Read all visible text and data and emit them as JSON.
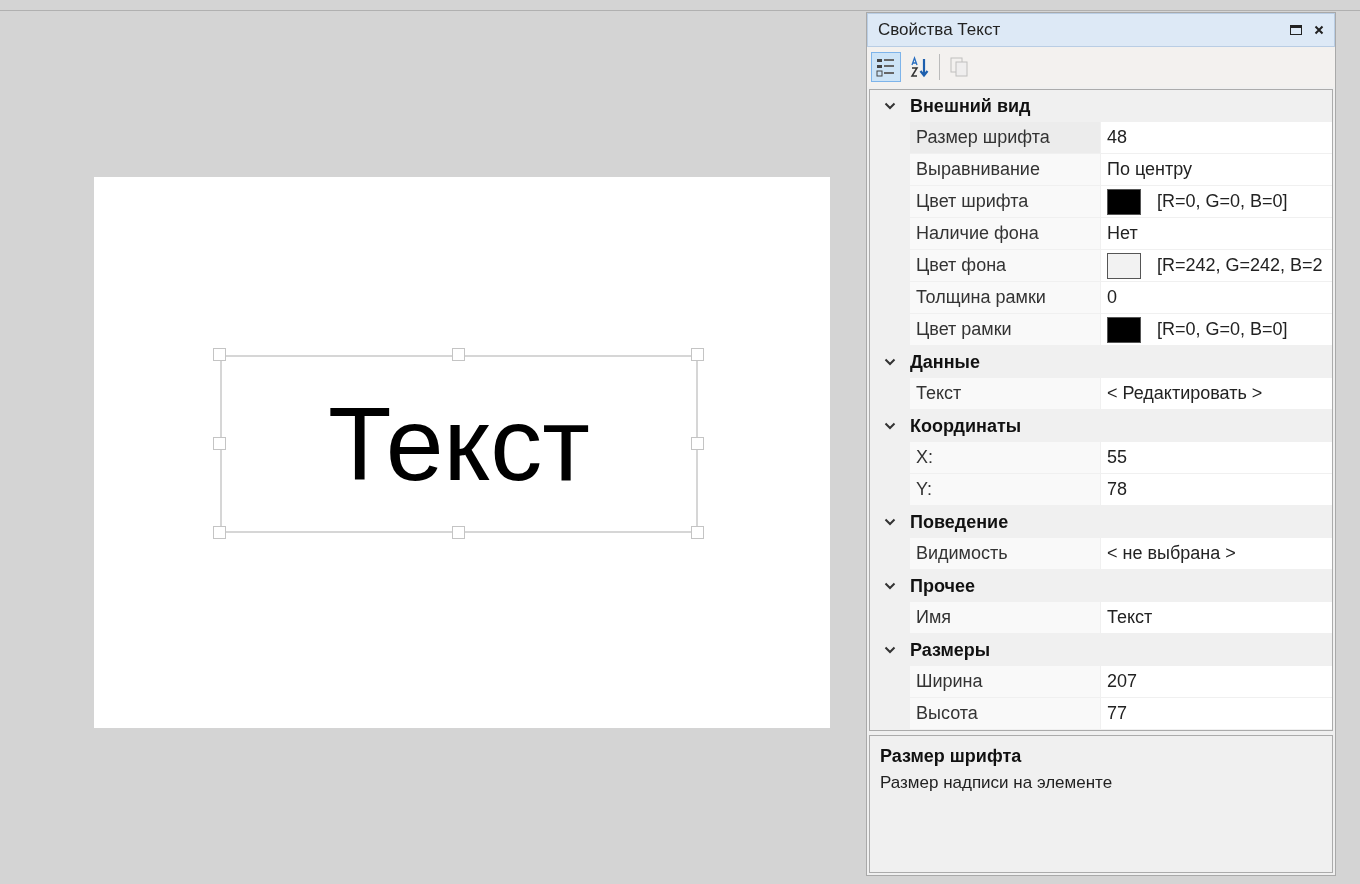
{
  "canvas": {
    "element": {
      "text": "Текст",
      "selected": true
    }
  },
  "panel": {
    "title": "Свойства Текст",
    "toolbar": [
      {
        "kind": "categorized",
        "selected": true,
        "disabled": false
      },
      {
        "kind": "alphabetical",
        "selected": false,
        "disabled": false
      },
      {
        "kind": "pages",
        "selected": false,
        "disabled": true
      }
    ],
    "groups": [
      {
        "name": "Внешний вид",
        "expanded": true,
        "properties": [
          {
            "kind": "text",
            "name": "Размер шрифта",
            "value": "48",
            "selected": true
          },
          {
            "kind": "text",
            "name": "Выравнивание",
            "value": "По центру",
            "selected": false
          },
          {
            "kind": "color",
            "name": "Цвет шрифта",
            "value": "[R=0, G=0, B=0]",
            "color": "#000000",
            "selected": false
          },
          {
            "kind": "text",
            "name": "Наличие фона",
            "value": "Нет",
            "selected": false
          },
          {
            "kind": "color",
            "name": "Цвет фона",
            "value": "[R=242, G=242, B=2",
            "color": "#f2f2f2",
            "selected": false
          },
          {
            "kind": "text",
            "name": "Толщина рамки",
            "value": "0",
            "selected": false
          },
          {
            "kind": "color",
            "name": "Цвет рамки",
            "value": "[R=0, G=0, B=0]",
            "color": "#000000",
            "selected": false
          }
        ]
      },
      {
        "name": "Данные",
        "expanded": true,
        "properties": [
          {
            "kind": "text",
            "name": "Текст",
            "value": "< Редактировать >",
            "selected": false
          }
        ]
      },
      {
        "name": "Координаты",
        "expanded": true,
        "properties": [
          {
            "kind": "text",
            "name": "X:",
            "value": "55",
            "selected": false
          },
          {
            "kind": "text",
            "name": "Y:",
            "value": "78",
            "selected": false
          }
        ]
      },
      {
        "name": "Поведение",
        "expanded": true,
        "properties": [
          {
            "kind": "text",
            "name": "Видимость",
            "value": "< не выбрана >",
            "selected": false
          }
        ]
      },
      {
        "name": "Прочее",
        "expanded": true,
        "properties": [
          {
            "kind": "text",
            "name": "Имя",
            "value": "Текст",
            "selected": false
          }
        ]
      },
      {
        "name": "Размеры",
        "expanded": true,
        "properties": [
          {
            "kind": "text",
            "name": "Ширина",
            "value": "207",
            "selected": false
          },
          {
            "kind": "text",
            "name": "Высота",
            "value": "77",
            "selected": false
          }
        ]
      }
    ],
    "description": {
      "title": "Размер шрифта",
      "text": "Размер надписи на элементе"
    }
  }
}
